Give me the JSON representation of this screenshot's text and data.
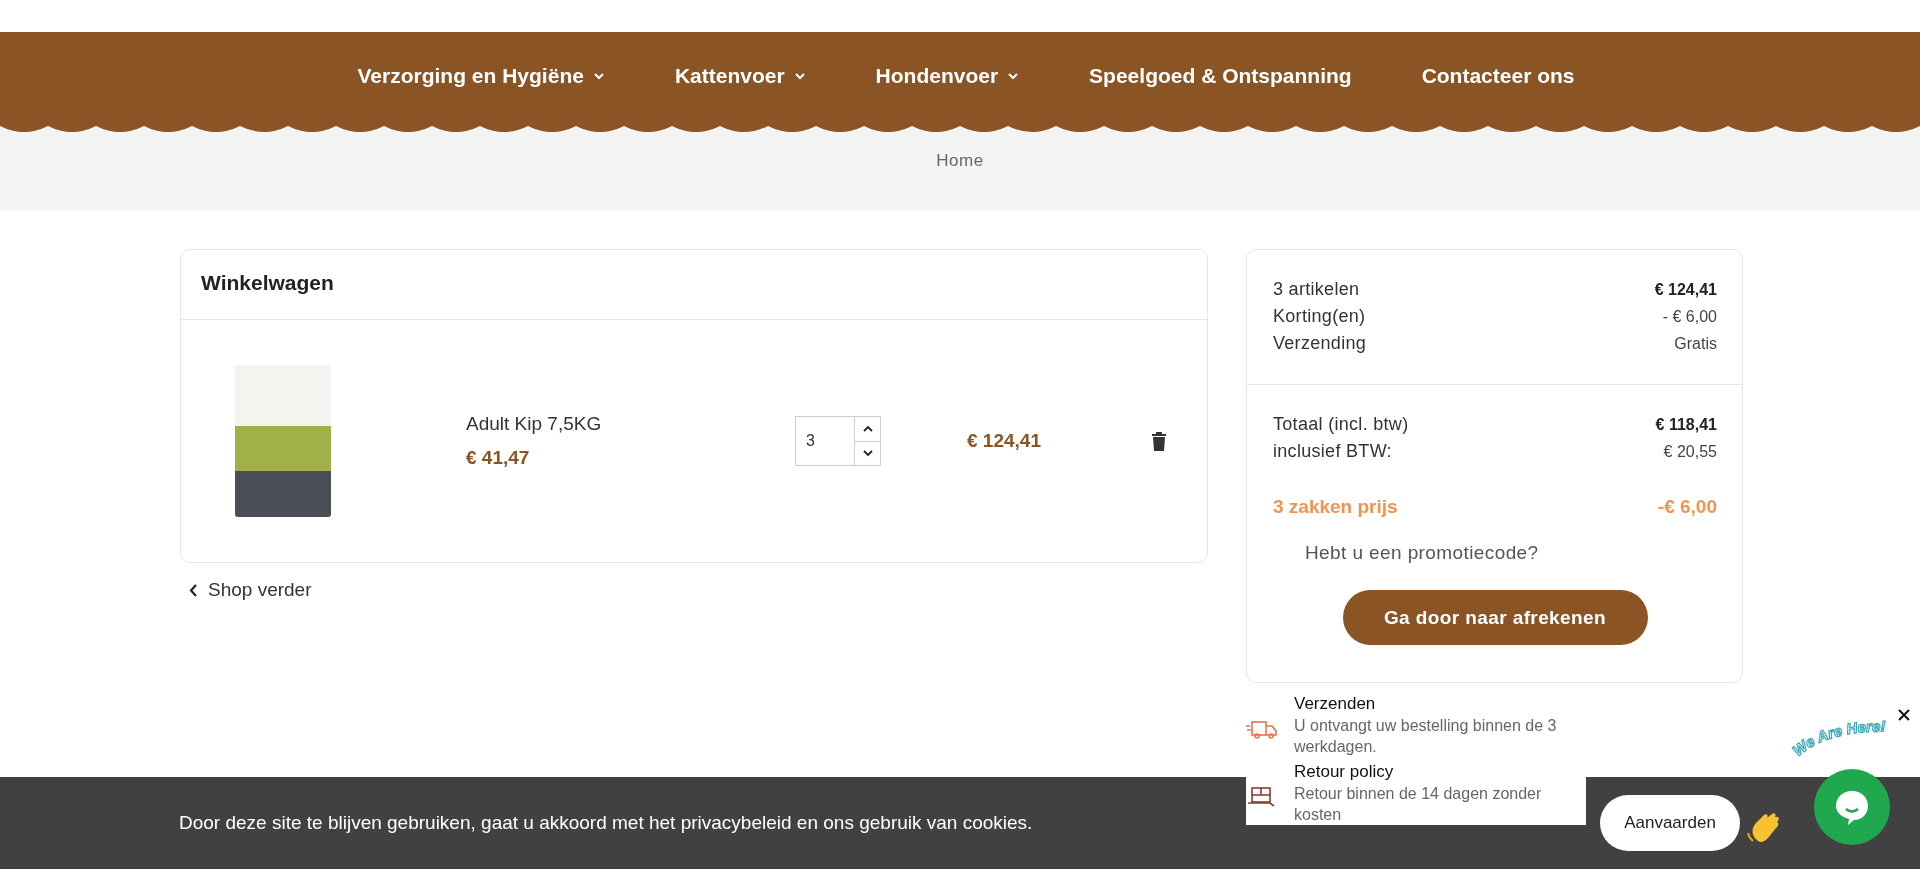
{
  "nav": {
    "items": [
      {
        "label": "Verzorging en Hygiëne",
        "dropdown": true
      },
      {
        "label": "Kattenvoer",
        "dropdown": true
      },
      {
        "label": "Hondenvoer",
        "dropdown": true
      },
      {
        "label": "Speelgoed & Ontspanning",
        "dropdown": false
      },
      {
        "label": "Contacteer ons",
        "dropdown": false
      }
    ]
  },
  "breadcrumb": [
    "Home"
  ],
  "cart": {
    "title": "Winkelwagen",
    "items": [
      {
        "name": "Adult Kip 7,5KG",
        "unit_price": "€ 41,47",
        "quantity": "3",
        "total": "€ 124,41"
      }
    ]
  },
  "continue_link": "Shop verder",
  "summary": {
    "lines": [
      {
        "label": "3 artikelen",
        "value": "€ 124,41",
        "strong": true
      },
      {
        "label": "Korting(en)",
        "value": "- € 6,00",
        "strong": false
      },
      {
        "label": "Verzending",
        "value": "Gratis",
        "strong": false
      }
    ],
    "totals": [
      {
        "label": "Totaal (incl. btw)",
        "value": "€ 118,41",
        "strong": true
      },
      {
        "label": "inclusief BTW:",
        "value": "€ 20,55",
        "strong": false
      }
    ],
    "discount": {
      "label": "3 zakken prijs",
      "value": "-€ 6,00"
    },
    "promo_link": "Hebt u een promotiecode?",
    "checkout_button": "Ga door naar afrekenen"
  },
  "features": [
    {
      "kind": "shipping",
      "title": "Verzenden",
      "text": "U ontvangt uw bestelling binnen de 3 werkdagen."
    },
    {
      "kind": "returns",
      "title": "Retour policy",
      "text": "Retour binnen de 14 dagen zonder kosten"
    }
  ],
  "cookie_bar": {
    "text": "Door deze site te blijven gebruiken, gaat u akkoord met het privacybeleid en ons gebruik van cookies.",
    "accept": "Aanvaarden"
  },
  "chat": {
    "badge_text": "We Are Here!"
  }
}
